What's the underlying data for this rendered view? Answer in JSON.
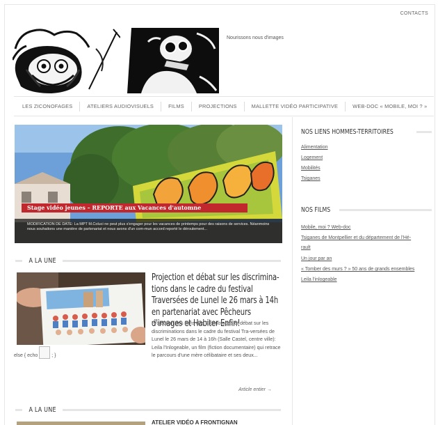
{
  "header": {
    "contacts_label": "CONTACTS",
    "tagline": "Nourissons nous d'images"
  },
  "nav": {
    "items": [
      "LES ZICONOFAGES",
      "ATELIERS AUDIOVISUELS",
      "FILMS",
      "PROJECTIONS",
      "MALLETTE VIDÉO PARTICIPATIVE",
      "WEB-DOC « MOBILE, MOI ? »"
    ]
  },
  "hero": {
    "title": "Stage vidéo jeunes – REPORTE aux Vacances d'automne",
    "caption": "MODIFICATION DE DATE: La MPT M.Coluci ne peut plus s'engager pour les vacances de printemps pour des raisons de services. Néanmoins nous souhaitons une manière de partenariat et nous avons d'un com-mun accord reporté le déroulement..."
  },
  "sections": {
    "a_la_une_1": "A LA UNE",
    "a_la_une_2": "A LA UNE"
  },
  "article": {
    "title": "Projection et débat sur les discrimina-tions dans le cadre du festival Traversées de Lunel le 26 mars à 14h en partenariat avec Pêcheurs d'images et Habiter Enfin!",
    "excerpt": "Projection des films des Ziconofages et débat sur les discriminations dans le cadre du festival Tra-versées de Lunel  le 26 mars de 14 à 16h (Salle Castel, centre ville): Leila l'Inlogeable, un film (fiction documentaire) qui retrace le parcours d'une mère célibataire et ses deux...",
    "broken_before": "else { echo ",
    "broken_after": "; }",
    "read_more": "Article entier →"
  },
  "next_article": {
    "title": "ATELIER VIDÉO A FRONTIGNAN"
  },
  "sidebar": {
    "links_heading": "NOS LIENS HOMMES-TERRITOIRES",
    "links": [
      "Alimentation",
      "Logement",
      "Mobilités",
      "Tsiganes"
    ],
    "films_heading": "NOS FILMS",
    "films": [
      "Mobile, moi ? Web-doc",
      "Tsiganes de Montpellier et du département de l'Hé-",
      "rault",
      "Un jour par an",
      "« Tomber des murs ? » 50 ans de grands ensembles",
      "Leila l'inlogeable"
    ]
  }
}
